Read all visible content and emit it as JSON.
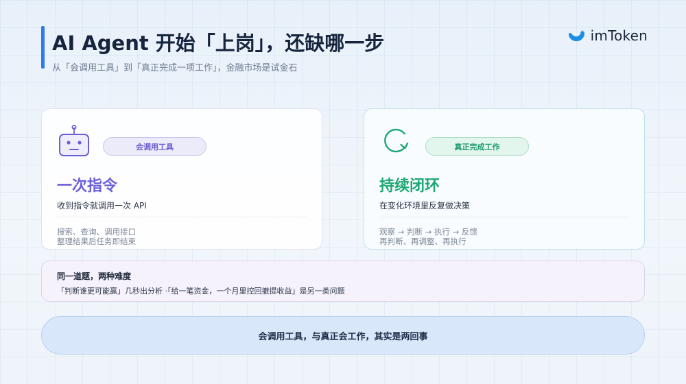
{
  "header": {
    "title": "AI Agent 开始「上岗」，还缺哪一步",
    "subtitle": "从「会调用工具」到「真正完成一项工作」，金融市场是试金石",
    "logo_text": "imToken",
    "logo_icon": "imtoken-logo-icon",
    "accent_color": "#2f7be8"
  },
  "cards": [
    {
      "icon": "robot-icon",
      "pill": "会调用工具",
      "title": "一次指令",
      "desc": "收到指令就调用一次 API",
      "detail_lines": [
        "搜索、查询、调用接口",
        "整理结果后任务即结束"
      ],
      "accent_color": "#6b5fd8"
    },
    {
      "icon": "loop-arrow-icon",
      "pill": "真正完成工作",
      "title": "持续闭环",
      "desc": "在变化环境里反复做决策",
      "detail_lines": [
        "观察 → 判断 → 执行 → 反馈",
        "再判断、再调整、再执行"
      ],
      "accent_color": "#1da774"
    }
  ],
  "note": {
    "title": "同一道题，两种难度",
    "text": "「判断谁更可能赢」几秒出分析 ·「给一笔资金，一个月里控回撤提收益」是另一类问题"
  },
  "banner": {
    "text": "会调用工具，与真正会工作，其实是两回事"
  }
}
